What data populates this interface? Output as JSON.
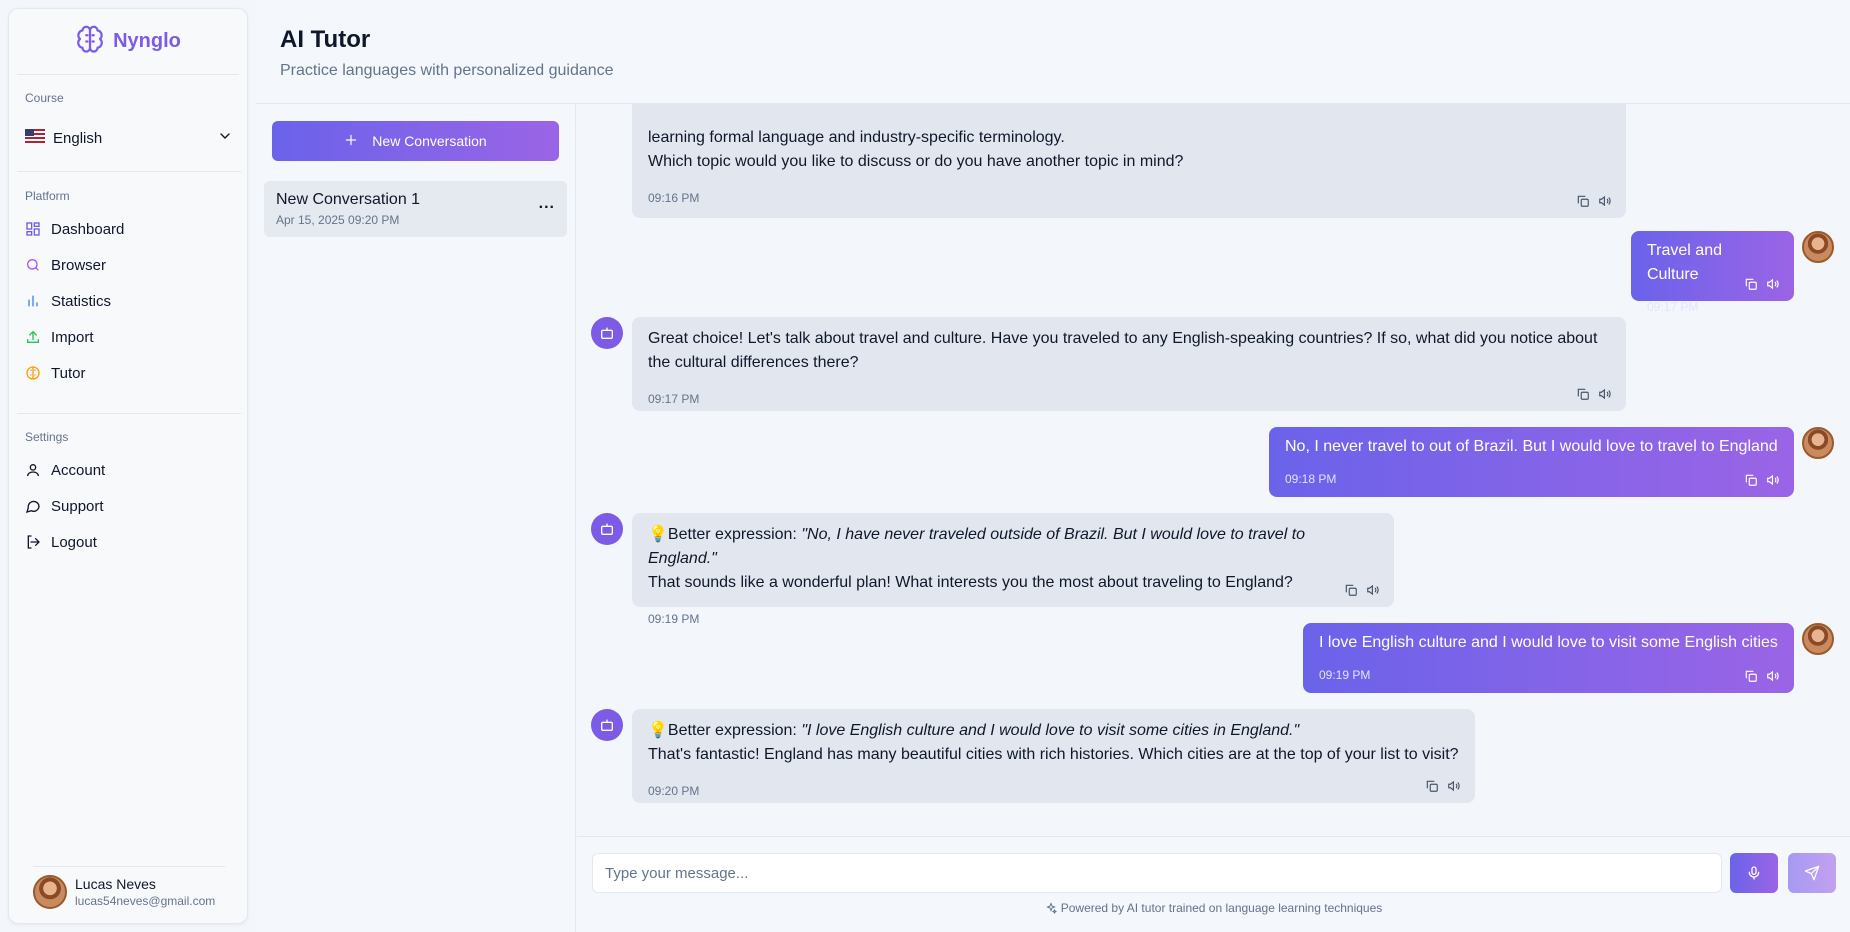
{
  "brand": {
    "name": "Nynglo",
    "accent": "#7c5ce6"
  },
  "sidebar": {
    "course_label": "Course",
    "course_value": "English",
    "platform_label": "Platform",
    "platform_items": [
      {
        "label": "Dashboard",
        "icon": "grid-icon"
      },
      {
        "label": "Browser",
        "icon": "search-icon"
      },
      {
        "label": "Statistics",
        "icon": "bar-chart-icon"
      },
      {
        "label": "Import",
        "icon": "upload-icon"
      },
      {
        "label": "Tutor",
        "icon": "brain-icon"
      }
    ],
    "settings_label": "Settings",
    "settings_items": [
      {
        "label": "Account",
        "icon": "user-icon"
      },
      {
        "label": "Support",
        "icon": "chat-bubble-icon"
      },
      {
        "label": "Logout",
        "icon": "logout-icon"
      }
    ],
    "user": {
      "name": "Lucas Neves",
      "email": "lucas54neves@gmail.com"
    }
  },
  "header": {
    "title": "AI Tutor",
    "subtitle": "Practice languages with personalized guidance"
  },
  "conversations": {
    "new_button": "New Conversation",
    "items": [
      {
        "title": "New Conversation 1",
        "date": "Apr 15, 2025 09:20 PM",
        "menu": "..."
      }
    ]
  },
  "chat": {
    "messages": [
      {
        "role": "bot",
        "lines": [
          "learning formal language and industry-specific terminology.",
          "Which topic would you like to discuss or do you have another topic in mind?"
        ],
        "time": "09:16 PM"
      },
      {
        "role": "user",
        "text": "Travel and Culture",
        "time": "09:17 PM"
      },
      {
        "role": "bot",
        "lines": [
          "Great choice! Let's talk about travel and culture. Have you traveled to any English-speaking countries? If so, what did you notice about",
          "the cultural differences there?"
        ],
        "time": "09:17 PM"
      },
      {
        "role": "user",
        "text": "No, I never travel to out of Brazil. But I would love to travel to England",
        "time": "09:18 PM"
      },
      {
        "role": "bot",
        "tip_prefix": "💡Better expression: ",
        "tip": "\"No, I have never traveled outside of Brazil. But I would love to travel to England.\"",
        "lines": [
          "That sounds like a wonderful plan! What interests you the most about traveling to England?"
        ],
        "time": "09:19 PM"
      },
      {
        "role": "user",
        "text": "I love English culture and I would love to visit some English cities",
        "time": "09:19 PM"
      },
      {
        "role": "bot",
        "tip_prefix": "💡Better expression: ",
        "tip": "\"I love English culture and I would love to visit some cities in England.\"",
        "lines": [
          "That's fantastic! England has many beautiful cities with rich histories. Which cities are at the top of your list to visit?"
        ],
        "time": "09:20 PM"
      }
    ]
  },
  "composer": {
    "placeholder": "Type your message...",
    "powered_by": "Powered by AI tutor trained on language learning techniques"
  }
}
